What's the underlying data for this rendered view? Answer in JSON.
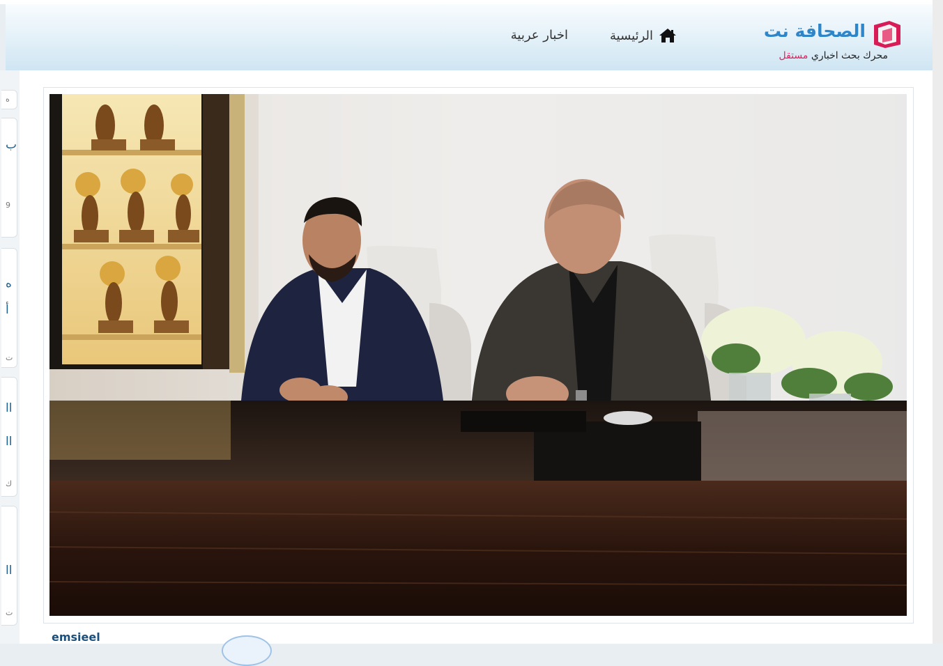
{
  "brand": {
    "title": "الصحافة نت",
    "tagline_prefix": "محرك بحث اخباري ",
    "tagline_accent": "مستقل",
    "accent_color": "#e0245e",
    "title_color": "#2e86c9"
  },
  "nav": {
    "home_label": "الرئيسية",
    "home_icon": "home-icon",
    "arab_news_label": "اخبار عربية"
  },
  "sidebar_fragments": [
    "ه",
    "ب",
    "9",
    "ه",
    "أ",
    "ت",
    "ll",
    "ll",
    "ك",
    "ll",
    "ت"
  ],
  "below_image_text": "emsieel"
}
